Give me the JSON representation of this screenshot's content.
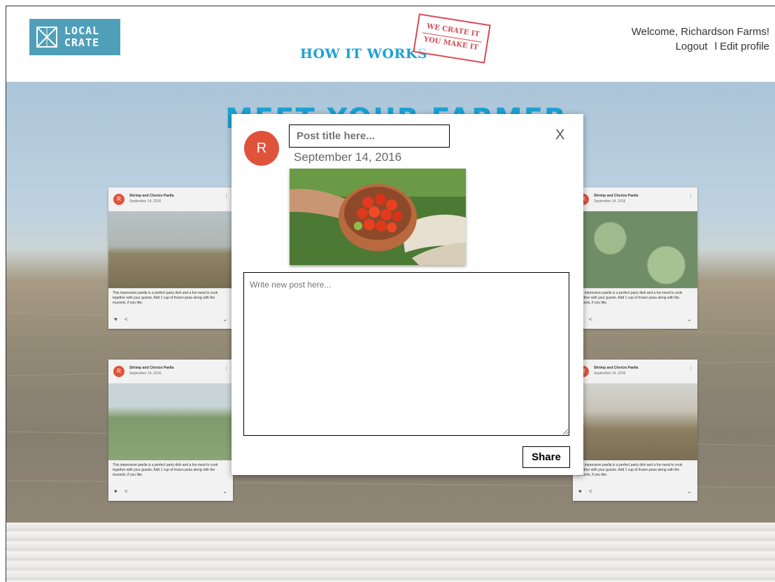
{
  "header": {
    "logo_line1": "LOCAL",
    "logo_line2": "CRATE",
    "nav_how_it_works": "HOW IT WORKS",
    "stamp_line1": "WE CRATE IT",
    "stamp_line2": "YOU MAKE IT",
    "welcome_text": "Welcome, Richardson Farms!",
    "logout": "Logout",
    "separator": "l",
    "edit_profile": "Edit profile"
  },
  "page": {
    "heading": "MEET YOUR FARMER"
  },
  "cards": [
    {
      "avatar": "R",
      "title": "Shrimp and Chorizo Paella",
      "date": "September 14, 2016",
      "text": "This impressive paella is a perfect party dish and a fun meal to cook together with your guests. Add 1 cup of frozen peas along with the mussels, if you like."
    },
    {
      "avatar": "R",
      "title": "Shrimp and Chorizo Paella",
      "date": "September 14, 2016",
      "text": "This impressive paella is a perfect party dish and a fun meal to cook together with your guests. Add 1 cup of frozen peas along with the mussels, if you like."
    },
    {
      "avatar": "R",
      "title": "Shrimp and Chorizo Paella",
      "date": "September 14, 2016",
      "text": "This impressive paella is a perfect party dish and a fun meal to cook together with your guests. Add 1 cup of frozen peas along with the mussels, if you like."
    },
    {
      "avatar": "R",
      "title": "Shrimp and Chorizo Paella",
      "date": "September 14, 2016",
      "text": "This impressive paella is a perfect party dish and a fun meal to cook together with your guests. Add 1 cup of frozen peas along with the mussels, if you like."
    }
  ],
  "modal": {
    "avatar": "R",
    "title_placeholder": "Post title here...",
    "date": "September 14, 2016",
    "close": "X",
    "body_placeholder": "Write new post here...",
    "share": "Share"
  },
  "icons": {
    "heart": "heart-icon",
    "share": "share-icon",
    "chevron": "chevron-down-icon",
    "menu": "more-vert-icon"
  },
  "colors": {
    "brand_blue": "#1ba2d4",
    "logo_bg": "#4f9fb8",
    "avatar_red": "#e0533b",
    "stamp_red": "#d94a55"
  }
}
